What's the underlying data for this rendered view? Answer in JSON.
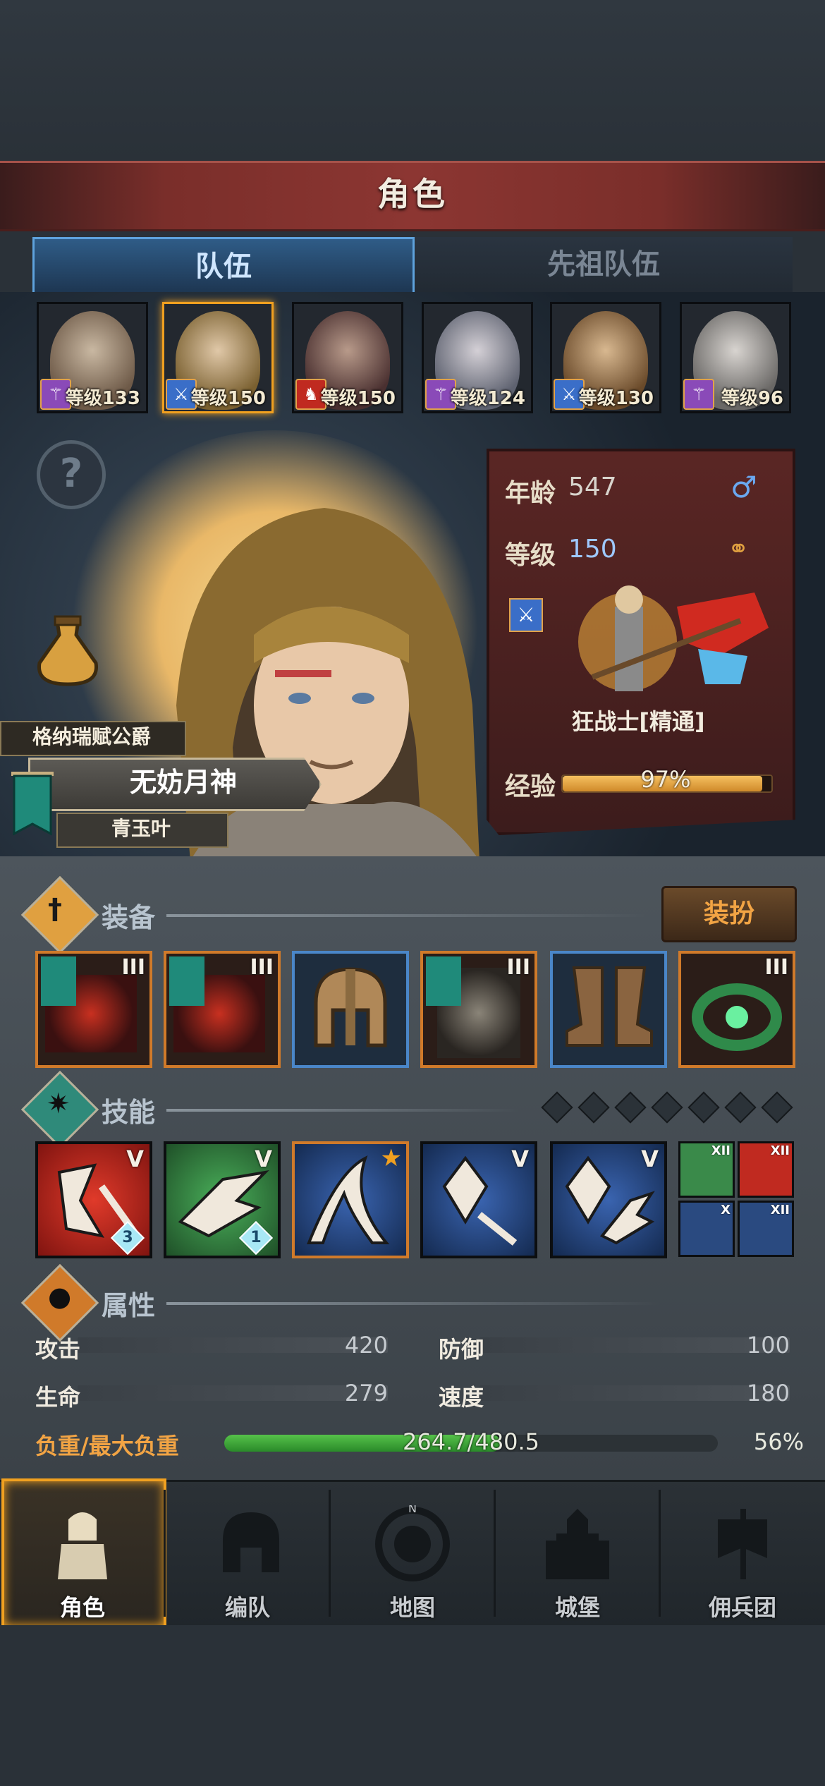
{
  "header": {
    "title": "角色"
  },
  "tabs": [
    {
      "label": "队伍",
      "active": true
    },
    {
      "label": "先祖队伍",
      "active": false
    }
  ],
  "team": [
    {
      "level_text": "等级133",
      "class_icon": "staff-icon",
      "class_color": "#8a4ab8",
      "selected": false
    },
    {
      "level_text": "等级150",
      "class_icon": "sword-icon",
      "class_color": "#3a6ec8",
      "selected": true
    },
    {
      "level_text": "等级150",
      "class_icon": "beast-icon",
      "class_color": "#c02a20",
      "selected": false
    },
    {
      "level_text": "等级124",
      "class_icon": "staff-icon",
      "class_color": "#8a4ab8",
      "selected": false
    },
    {
      "level_text": "等级130",
      "class_icon": "sword-icon",
      "class_color": "#3a6ec8",
      "selected": false
    },
    {
      "level_text": "等级96",
      "class_icon": "staff-icon",
      "class_color": "#8a4ab8",
      "selected": false
    }
  ],
  "hero": {
    "title": "格纳瑞赋公爵",
    "name": "无妨月神",
    "subtitle": "青玉叶"
  },
  "stats_panel": {
    "age_label": "年龄",
    "age_value": "547",
    "gender_icon": "male-icon",
    "level_label": "等级",
    "level_value": "150",
    "ring_icon": "rings-icon",
    "class_name": "狂战士[精通]",
    "exp_label": "经验",
    "exp_text": "97%",
    "exp_fraction": 0.97
  },
  "equipment": {
    "title": "装备",
    "dress_button": "装扮",
    "slots": [
      {
        "name": "weapon",
        "tier": "III",
        "rarity": "orange"
      },
      {
        "name": "offhand",
        "tier": "III",
        "rarity": "orange"
      },
      {
        "name": "helmet",
        "tier": "",
        "rarity": "blue"
      },
      {
        "name": "armor",
        "tier": "III",
        "rarity": "orange"
      },
      {
        "name": "boots",
        "tier": "",
        "rarity": "blue"
      },
      {
        "name": "ring",
        "tier": "III",
        "rarity": "orange"
      }
    ]
  },
  "skills": {
    "title": "技能",
    "points": 7,
    "list": [
      {
        "tier": "V",
        "badge": "3",
        "color": "#b8221c"
      },
      {
        "tier": "V",
        "badge": "1",
        "color": "#2f7a3a"
      },
      {
        "tier": "",
        "badge": "",
        "color": "#1e3e72",
        "star": true
      },
      {
        "tier": "V",
        "badge": "",
        "color": "#1e3e72"
      },
      {
        "tier": "V",
        "badge": "",
        "color": "#1e3e72"
      }
    ],
    "mini": [
      {
        "tier": "XII",
        "color": "#2f7a3a"
      },
      {
        "tier": "XII",
        "color": "#b8221c"
      },
      {
        "tier": "X",
        "color": "#1e3e72"
      },
      {
        "tier": "XII",
        "color": "#1e3e72"
      }
    ]
  },
  "attributes": {
    "title": "属性",
    "items": [
      {
        "label": "攻击",
        "value": "420"
      },
      {
        "label": "防御",
        "value": "100"
      },
      {
        "label": "生命",
        "value": "279"
      },
      {
        "label": "速度",
        "value": "180"
      }
    ],
    "load_label": "负重/最大负重",
    "load_text": "264.7/480.5",
    "load_percent": "56%",
    "load_fraction": 0.56
  },
  "nav": [
    {
      "label": "角色",
      "icon": "knight-icon",
      "active": true
    },
    {
      "label": "编队",
      "icon": "helmet-icon",
      "active": false
    },
    {
      "label": "地图",
      "icon": "compass-icon",
      "active": false
    },
    {
      "label": "城堡",
      "icon": "castle-icon",
      "active": false
    },
    {
      "label": "佣兵团",
      "icon": "banner-icon",
      "active": false
    }
  ],
  "colors": {
    "accent": "#f0a020",
    "title_bar": "#8c3632",
    "tab_active": "#5ea2dc",
    "exp": "#e0a040",
    "load": "#4ab040"
  }
}
